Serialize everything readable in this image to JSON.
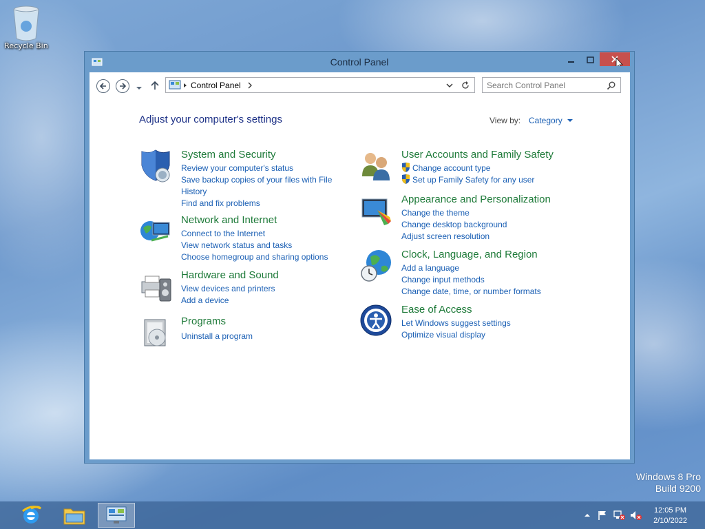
{
  "desktop": {
    "recycle_bin_label": "Recycle Bin",
    "os_name": "Windows 8 Pro",
    "os_build": "Build 9200"
  },
  "window": {
    "title": "Control Panel",
    "breadcrumb": "Control Panel",
    "search_placeholder": "Search Control Panel",
    "heading": "Adjust your computer's settings",
    "view_by_label": "View by:",
    "view_by_value": "Category"
  },
  "categories": {
    "system": {
      "title": "System and Security",
      "links": [
        "Review your computer's status",
        "Save backup copies of your files with File",
        "History",
        "Find and fix problems"
      ]
    },
    "network": {
      "title": "Network and Internet",
      "links": [
        "Connect to the Internet",
        "View network status and tasks",
        "Choose homegroup and sharing options"
      ]
    },
    "hardware": {
      "title": "Hardware and Sound",
      "links": [
        "View devices and printers",
        "Add a device"
      ]
    },
    "programs": {
      "title": "Programs",
      "links": [
        "Uninstall a program"
      ]
    },
    "users": {
      "title": "User Accounts and Family Safety",
      "links": [
        "Change account type",
        "Set up Family Safety for any user"
      ]
    },
    "appearance": {
      "title": "Appearance and Personalization",
      "links": [
        "Change the theme",
        "Change desktop background",
        "Adjust screen resolution"
      ]
    },
    "clock": {
      "title": "Clock, Language, and Region",
      "links": [
        "Add a language",
        "Change input methods",
        "Change date, time, or number formats"
      ]
    },
    "ease": {
      "title": "Ease of Access",
      "links": [
        "Let Windows suggest settings",
        "Optimize visual display"
      ]
    }
  },
  "taskbar": {
    "time": "12:05 PM",
    "date": "2/10/2022",
    "apps": [
      "internet-explorer-icon",
      "file-explorer-icon",
      "control-panel-icon"
    ]
  },
  "colors": {
    "category_title": "#1e7a39",
    "link": "#1a5fb4",
    "heading": "#1e3287",
    "close_button": "#c7504d"
  }
}
